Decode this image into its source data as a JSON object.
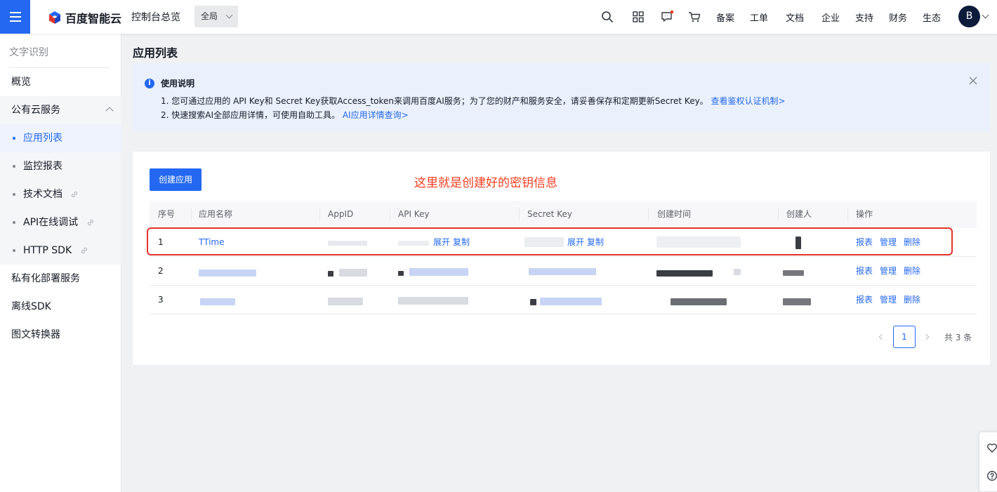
{
  "topbar": {
    "logo_text": "百度智能云",
    "console_title": "控制台总览",
    "region": "全局",
    "nav": [
      "备案",
      "工单",
      "文档",
      "企业",
      "支持",
      "财务",
      "生态"
    ],
    "avatar_letter": "B"
  },
  "sidebar": {
    "title": "文字识别",
    "items": [
      {
        "label": "概览"
      },
      {
        "label": "公有云服务"
      },
      {
        "label": "应用列表"
      },
      {
        "label": "监控报表"
      },
      {
        "label": "技术文档"
      },
      {
        "label": "API在线调试"
      },
      {
        "label": "HTTP SDK"
      },
      {
        "label": "私有化部署服务"
      },
      {
        "label": "离线SDK"
      },
      {
        "label": "图文转换器"
      }
    ]
  },
  "main": {
    "title": "应用列表",
    "notice": {
      "title": "使用说明",
      "line1_text": "1. 您可通过应用的 API Key和 Secret Key获取Access_token来调用百度AI服务；为了您的财产和服务安全，请妥善保存和定期更新Secret Key。",
      "line1_link": "查看鉴权认证机制>",
      "line2_text": "2. 快速搜索AI全部应用详情，可使用自助工具。",
      "line2_link": "AI应用详情查询>"
    },
    "create_button": "创建应用",
    "annotation": "这里就是创建好的密钥信息",
    "table": {
      "headers": [
        "序号",
        "应用名称",
        "AppID",
        "API Key",
        "Secret Key",
        "创建时间",
        "创建人",
        "操作"
      ],
      "rows": [
        {
          "index": "1",
          "name": "TTime",
          "expand": "展开",
          "copy": "复制"
        },
        {
          "index": "2"
        },
        {
          "index": "3"
        }
      ],
      "ops": [
        "报表",
        "管理",
        "删除"
      ]
    },
    "pagination": {
      "current": "1",
      "total": "共 3 条"
    }
  },
  "colors": {
    "primary": "#2468f2",
    "annotation": "#f33e1f",
    "notice_bg": "#eaf1fd"
  }
}
